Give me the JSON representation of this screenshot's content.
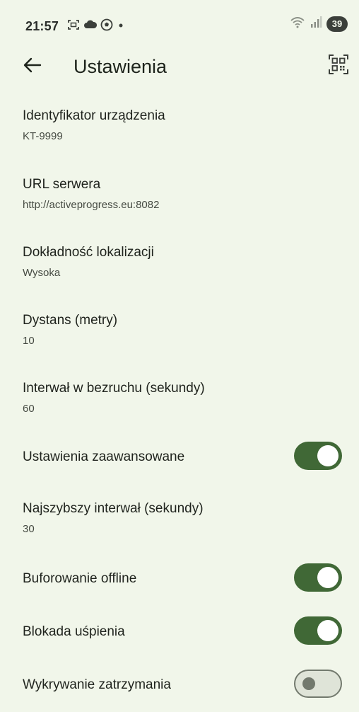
{
  "status_bar": {
    "time": "21:57",
    "battery": "39",
    "notification_icons": [
      "screenshot-icon",
      "cloud-icon",
      "soccer-ball-icon",
      "dot-icon"
    ],
    "right_icons": [
      "wifi-icon",
      "signal-icon",
      "battery-icon"
    ]
  },
  "app_bar": {
    "title": "Ustawienia",
    "back_icon": "arrow-left-icon",
    "action_icon": "qr-code-scanner-icon"
  },
  "settings": [
    {
      "title": "Identyfikator urządzenia",
      "value": "KT-9999"
    },
    {
      "title": "URL serwera",
      "value": "http://activeprogress.eu:8082"
    },
    {
      "title": "Dokładność lokalizacji",
      "value": "Wysoka"
    },
    {
      "title": "Dystans (metry)",
      "value": "10"
    },
    {
      "title": "Interwał w bezruchu (sekundy)",
      "value": "60"
    },
    {
      "title": "Ustawienia zaawansowane",
      "switch_on": true
    },
    {
      "title": "Najszybszy interwał (sekundy)",
      "value": "30"
    },
    {
      "title": "Buforowanie offline",
      "switch_on": true
    },
    {
      "title": "Blokada uśpienia",
      "switch_on": true
    },
    {
      "title": "Wykrywanie zatrzymania",
      "switch_on": false
    }
  ],
  "colors": {
    "background": "#f1f6ea",
    "switch_on": "#406836",
    "switch_off_track": "#dfe4d8",
    "switch_off_thumb": "#72796d"
  }
}
